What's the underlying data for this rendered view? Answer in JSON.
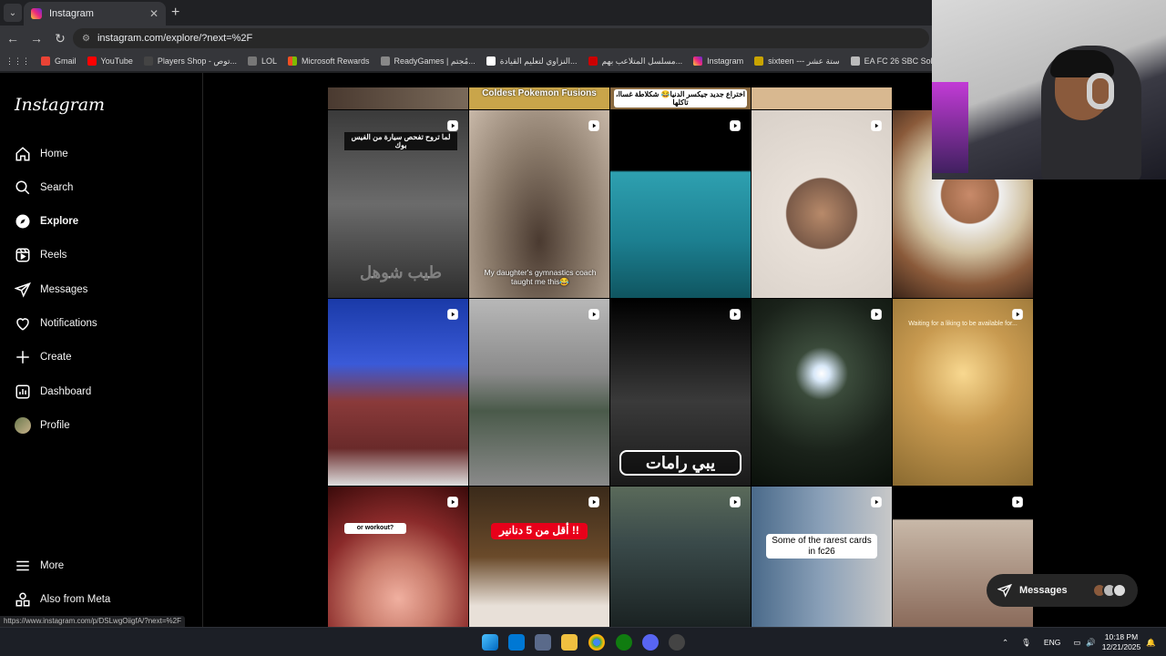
{
  "browser": {
    "tab_title": "Instagram",
    "url": "instagram.com/explore/?next=%2F",
    "bookmarks": [
      "Gmail",
      "YouTube",
      "Players Shop - توص...",
      "LOL",
      "Microsoft Rewards",
      "ReadyGames | مُجتم...",
      "النزاوي لتعليم القيادة...",
      "مسلسل المتلاعب بهم...",
      "Instagram",
      "sixteen --- ستة عشر",
      "EA FC 26 SBC Soluti..."
    ],
    "status_url": "https://www.instagram.com/p/DSLwgOiigfA/?next=%2F"
  },
  "sidebar": {
    "logo": "Instagram",
    "items": [
      {
        "label": "Home",
        "icon": "home-icon"
      },
      {
        "label": "Search",
        "icon": "search-icon"
      },
      {
        "label": "Explore",
        "icon": "compass-icon"
      },
      {
        "label": "Reels",
        "icon": "reels-icon"
      },
      {
        "label": "Messages",
        "icon": "messenger-icon"
      },
      {
        "label": "Notifications",
        "icon": "heart-icon"
      },
      {
        "label": "Create",
        "icon": "plus-icon"
      },
      {
        "label": "Dashboard",
        "icon": "dashboard-icon"
      },
      {
        "label": "Profile",
        "icon": "avatar"
      }
    ],
    "bottom": [
      {
        "label": "More",
        "icon": "menu-icon"
      },
      {
        "label": "Also from Meta",
        "icon": "meta-apps-icon"
      }
    ]
  },
  "grid": {
    "top_row_captions": [
      "Coldest Pokemon Fusions",
      "اختراع جديد جيكسر الدنيا😂 شكلاطة غساا، تاكلها"
    ],
    "row1_captions": [
      "لما تروح تفحص سيارة من الفيس بوك",
      "My daughter's gymnastics coach taught me this😂",
      "طيب شوهل"
    ],
    "row2_captions": [
      "Waiting for a liking to be available for...",
      "يبي رامات"
    ],
    "row3_captions": [
      "or workout?",
      "أقل من 5 دنانير !!",
      "Some of the rarest cards in fc26"
    ]
  },
  "messages_pill": {
    "label": "Messages"
  },
  "taskbar": {
    "tray_lang": "ENG",
    "time": "10:18 PM",
    "date": "12/21/2025"
  },
  "colors": {
    "instagram_gradient": [
      "#f9ce34",
      "#ee2a7b",
      "#6228d7"
    ],
    "background": "#000000"
  }
}
